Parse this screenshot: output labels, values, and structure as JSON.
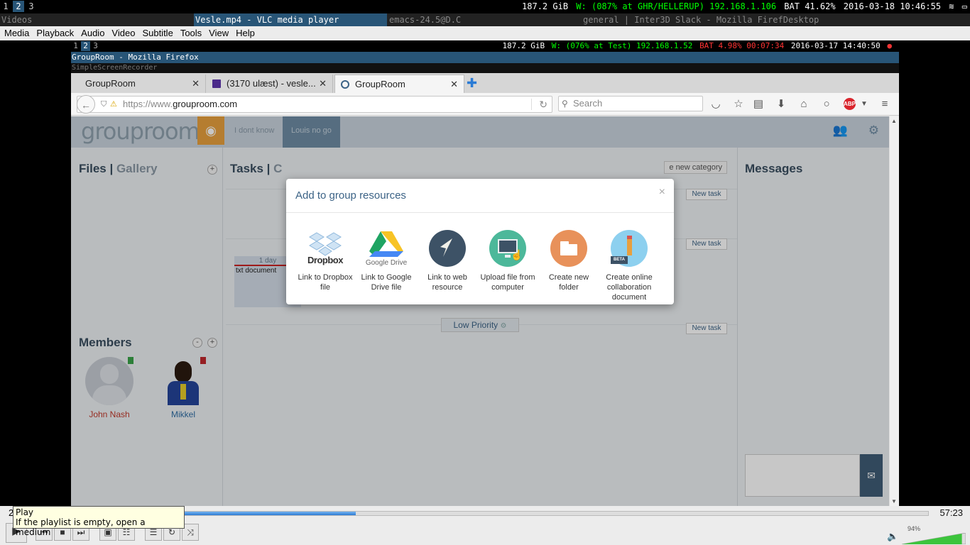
{
  "wm": {
    "workspaces": [
      "1",
      "2",
      "3"
    ],
    "disk": "187.2 GiB",
    "wifi": "W: (087% at GHR/HELLERUP) 192.168.1.106",
    "battery": "BAT 41.62%",
    "datetime": "2016-03-18 10:46:55",
    "windows": [
      "Videos",
      "Vesle.mp4 - VLC media player",
      "emacs-24.5@D.C",
      "general | Inter3D Slack - Mozilla FirefDesktop"
    ]
  },
  "vlc": {
    "menu": [
      "Media",
      "Playback",
      "Audio",
      "Video",
      "Subtitle",
      "Tools",
      "View",
      "Help"
    ],
    "time_elapsed": "2",
    "time_total": "57:23",
    "progress": 0.364,
    "volume": "94%",
    "tooltip_title": "Play",
    "tooltip_text": "If the playlist is empty, open a medium"
  },
  "inner": {
    "workspaces": [
      "1",
      "2",
      "3"
    ],
    "disk": "187.2 GiB",
    "wifi": "W: (076% at Test) 192.168.1.52",
    "battery": "BAT 4.98% 00:07:34",
    "datetime": "2016-03-17 14:40:50",
    "firefox_title": "GroupRoom - Mozilla Firefox",
    "recorder_title": "SimpleScreenRecorder"
  },
  "firefox": {
    "tabs": [
      {
        "label": "GroupRoom"
      },
      {
        "label": "(3170 ulæst) - vesle..."
      },
      {
        "label": "GroupRoom"
      }
    ],
    "url_prefix": "https://www.",
    "url_domain": "grouproom.com",
    "search_placeholder": "Search"
  },
  "app": {
    "logo": "grouproom",
    "tabs": [
      "I dont know",
      "Louis no go"
    ],
    "files_title": "Files",
    "gallery_title": "Gallery",
    "tasks_title": "Tasks",
    "tasks_extra": "C",
    "new_category": "e new category",
    "new_task": "New task",
    "task_card_due": "1 day",
    "task_card_name": "txt document",
    "low_priority": "Low Priority",
    "members_title": "Members",
    "members": [
      {
        "name": "John Nash",
        "color": "#c0392b"
      },
      {
        "name": "Mikkel",
        "color": "#2e6da4"
      }
    ],
    "messages_title": "Messages"
  },
  "modal": {
    "title": "Add to group resources",
    "close": "×",
    "resources": [
      {
        "label": "Link to Dropbox file",
        "icon": "dropbox-icon",
        "brand": "Dropbox"
      },
      {
        "label": "Link to Google Drive file",
        "icon": "google-drive-icon",
        "brand": "Google Drive"
      },
      {
        "label": "Link to web resource",
        "icon": "web-link-icon"
      },
      {
        "label": "Upload file from computer",
        "icon": "upload-computer-icon"
      },
      {
        "label": "Create new folder",
        "icon": "folder-icon"
      },
      {
        "label": "Create online collaboration document",
        "icon": "collab-doc-icon",
        "badge": "BETA"
      }
    ]
  },
  "colors": {
    "accent": "#285577",
    "gr_blue": "#3c6386",
    "gr_orange": "#e8a03e"
  }
}
